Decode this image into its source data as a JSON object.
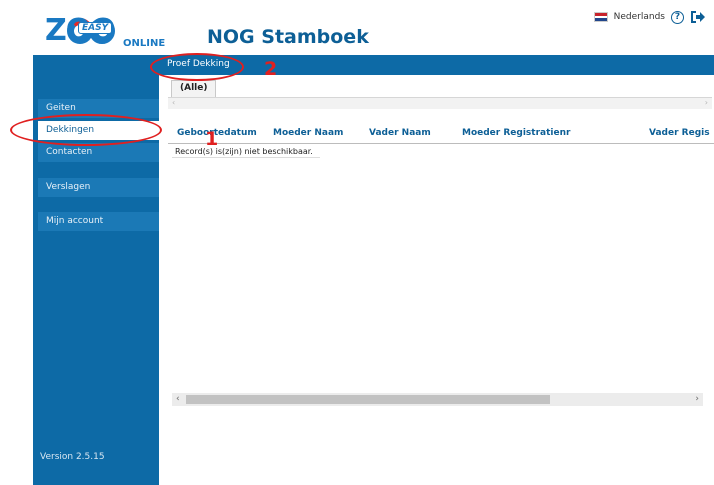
{
  "logo": {
    "brand": "ZOO",
    "sub": "EASY",
    "tag": "ONLINE"
  },
  "app_title": "NOG Stamboek",
  "header": {
    "language": "Nederlands",
    "help_glyph": "?",
    "logout_icon": "logout-icon"
  },
  "topbar": {
    "link": "Proef Dekking"
  },
  "tabs": [
    {
      "label": "(Alle)"
    }
  ],
  "sidebar": {
    "items": [
      {
        "label": "Geiten"
      },
      {
        "label": "Dekkingen",
        "active": true
      },
      {
        "label": "Contacten"
      },
      {
        "label": "Verslagen"
      },
      {
        "label": "Mijn account"
      }
    ],
    "version": "Version 2.5.15"
  },
  "grid": {
    "columns": [
      "Geboortedatum",
      "Moeder Naam",
      "Vader Naam",
      "Moeder Registratienr",
      "Vader Regis"
    ],
    "empty_message": "Record(s) is(zijn) niet beschikbaar."
  },
  "annotations": {
    "first": "1",
    "second": "2"
  },
  "colors": {
    "brand_blue": "#0d6aa6",
    "title_blue": "#0d5f96",
    "annotation_red": "#e02020"
  }
}
